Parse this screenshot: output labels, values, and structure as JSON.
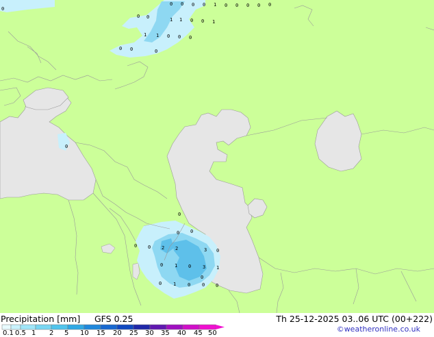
{
  "header": {
    "title": "Precipitation [mm]",
    "model": "GFS 0.25",
    "validity": "Th 25-12-2025 03..06 UTC (00+222)"
  },
  "credit": "©weatheronline.co.uk",
  "legend": {
    "labels": [
      "0.1",
      "0.5",
      "1",
      "2",
      "5",
      "10",
      "15",
      "20",
      "25",
      "30",
      "35",
      "40",
      "45",
      "50"
    ],
    "colors": [
      "#e8fbff",
      "#c8f2fc",
      "#a0e6f8",
      "#78d6f2",
      "#50c4ec",
      "#30a8e4",
      "#2088dc",
      "#1868d0",
      "#1048c0",
      "#2028a8",
      "#6018b0",
      "#a010c0",
      "#d010c8",
      "#f010d0"
    ]
  },
  "colors": {
    "land": "#ccff99",
    "water": "#e6e6e6",
    "border": "#999999",
    "precip_light": "#c8f0fc",
    "precip_mid": "#8ed8f2",
    "precip_heavy": "#5ec0ea"
  },
  "grid_values": [
    {
      "v": "0"
    },
    {
      "v": "0"
    },
    {
      "v": "0"
    },
    {
      "v": "0"
    },
    {
      "v": "1"
    },
    {
      "v": "0"
    },
    {
      "v": "0"
    },
    {
      "v": "0"
    },
    {
      "v": "0"
    },
    {
      "v": "0"
    },
    {
      "v": "0"
    },
    {
      "v": "0"
    },
    {
      "v": "1"
    },
    {
      "v": "1"
    },
    {
      "v": "0"
    },
    {
      "v": "0"
    },
    {
      "v": "1"
    },
    {
      "v": "1"
    },
    {
      "v": "1"
    },
    {
      "v": "0"
    },
    {
      "v": "0"
    },
    {
      "v": "0"
    },
    {
      "v": "0"
    },
    {
      "v": "0"
    },
    {
      "v": "0"
    },
    {
      "v": "0"
    },
    {
      "v": "0"
    },
    {
      "v": "0"
    },
    {
      "v": "0"
    },
    {
      "v": "0"
    },
    {
      "v": "0"
    },
    {
      "v": "2"
    },
    {
      "v": "2"
    },
    {
      "v": "3"
    },
    {
      "v": "0"
    },
    {
      "v": "0"
    },
    {
      "v": "1"
    },
    {
      "v": "0"
    },
    {
      "v": "3"
    },
    {
      "v": "1"
    },
    {
      "v": "0"
    },
    {
      "v": "1"
    },
    {
      "v": "0"
    },
    {
      "v": "0"
    },
    {
      "v": "0"
    },
    {
      "v": "0"
    },
    {
      "v": "0"
    }
  ]
}
